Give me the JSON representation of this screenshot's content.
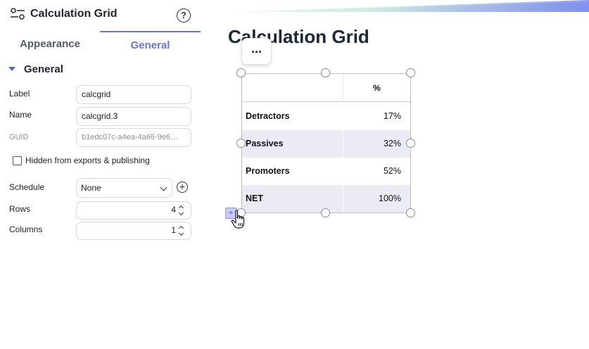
{
  "panel": {
    "title": "Calculation Grid",
    "help_icon": "?",
    "tabs": [
      {
        "label": "Appearance",
        "active": false
      },
      {
        "label": "General",
        "active": true
      }
    ],
    "section_title": "General",
    "fields": {
      "label": {
        "label": "Label",
        "value": "calcgrid"
      },
      "name": {
        "label": "Name",
        "value": "calcgrid.3"
      },
      "guid": {
        "label": "GUID",
        "value": "b1edc07c-a4ea-4a66-9e6…"
      }
    },
    "hidden_checkbox": {
      "label": "Hidden from exports & publishing",
      "checked": false
    },
    "schedule": {
      "label": "Schedule",
      "value": "None"
    },
    "rows": {
      "label": "Rows",
      "value": "4"
    },
    "columns": {
      "label": "Columns",
      "value": "1"
    }
  },
  "canvas": {
    "page_title": "Calculation Grid",
    "more_button": "...",
    "grid": {
      "column_header": "%",
      "rows": [
        {
          "label": "Detractors",
          "value": "17%"
        },
        {
          "label": "Passives",
          "value": "32%"
        },
        {
          "label": "Promoters",
          "value": "52%"
        },
        {
          "label": "NET",
          "value": "100%"
        }
      ]
    },
    "add_row_icon": "+"
  },
  "colors": {
    "accent": "#6b77c9",
    "row_alt": "#ebebf6",
    "title": "#1d2735"
  }
}
